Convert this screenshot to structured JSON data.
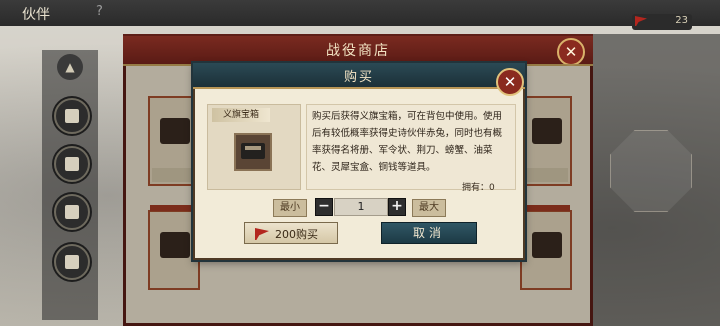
{
  "topbar": {
    "title": "伙伴",
    "help": "?",
    "coin_count": "23"
  },
  "shop": {
    "title": "战役商店"
  },
  "modal": {
    "title": "购买",
    "item_name": "义旗宝箱",
    "description": "购买后获得义旗宝箱，可在背包中使用。使用后有较低概率获得史诗伙伴赤兔，同时也有概率获得名将册、军令状、荆刀、螃蟹、油菜花、灵犀宝盒、铜钱等道具。",
    "owned_label": "拥有：",
    "owned_value": "0",
    "min_label": "最小",
    "max_label": "最大",
    "minus": "−",
    "plus": "+",
    "quantity": "1",
    "buy_label": "200购买",
    "cancel_label": "取消"
  }
}
